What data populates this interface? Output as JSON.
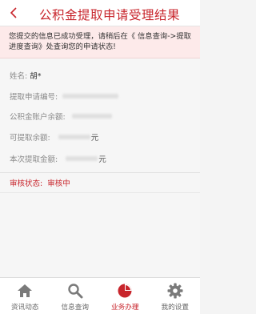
{
  "header": {
    "title": "公积金提取申请受理结果"
  },
  "notice": {
    "text": "您提交的信息已成功受理，请稍后在《 信息查询->提取进度查询》处查询您的申请状态!"
  },
  "fields": [
    {
      "label": "姓名:",
      "value": "胡*",
      "unit": ""
    },
    {
      "label": "提取申请编号:",
      "value": "",
      "unit": ""
    },
    {
      "label": "公积金账户余额:",
      "value": "",
      "unit": ""
    },
    {
      "label": "可提取余额:",
      "value": "",
      "unit": "元"
    },
    {
      "label": "本次提取金额:",
      "value": "",
      "unit": "元"
    }
  ],
  "status": {
    "label": "审核状态:",
    "value": "审核中"
  },
  "tabbar": {
    "items": [
      {
        "label": "资讯动态",
        "icon": "home-icon",
        "active": false
      },
      {
        "label": "信息查询",
        "icon": "search-icon",
        "active": false
      },
      {
        "label": "业务办理",
        "icon": "pie-chart-icon",
        "active": true
      },
      {
        "label": "我的设置",
        "icon": "gear-icon",
        "active": false
      }
    ]
  },
  "colors": {
    "accent": "#c8252c",
    "notice_bg": "#fdeaea",
    "inactive_icon": "#777777"
  }
}
